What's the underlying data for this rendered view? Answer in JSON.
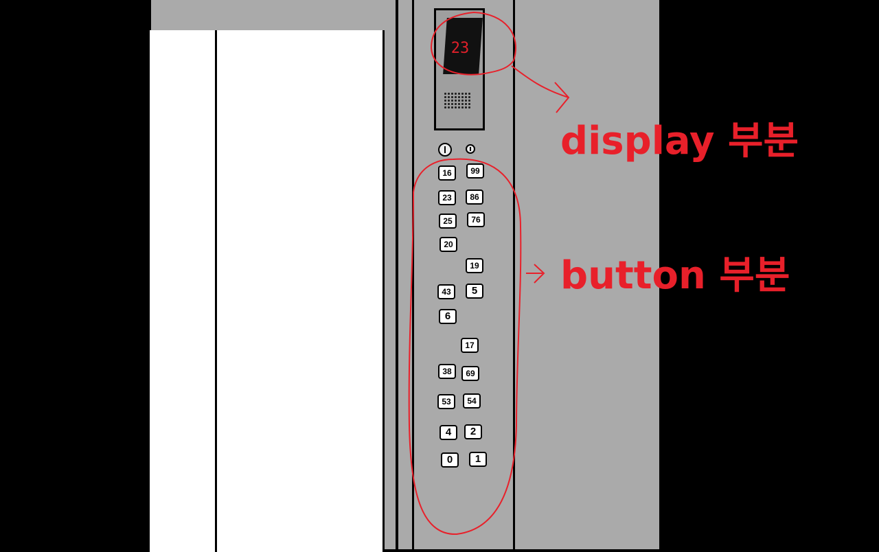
{
  "display": {
    "floor": "23"
  },
  "panel": {
    "top_buttons": [
      "open-door",
      "close-door"
    ],
    "floor_buttons": [
      "16",
      "99",
      "23",
      "86",
      "25",
      "76",
      "20",
      "19",
      "43",
      "5",
      "6",
      "17",
      "38",
      "69",
      "53",
      "54",
      "4",
      "2",
      "0",
      "1"
    ]
  },
  "annotations": {
    "display_label": "display 부분",
    "button_label": "button 부분",
    "color": "#e8202a"
  }
}
